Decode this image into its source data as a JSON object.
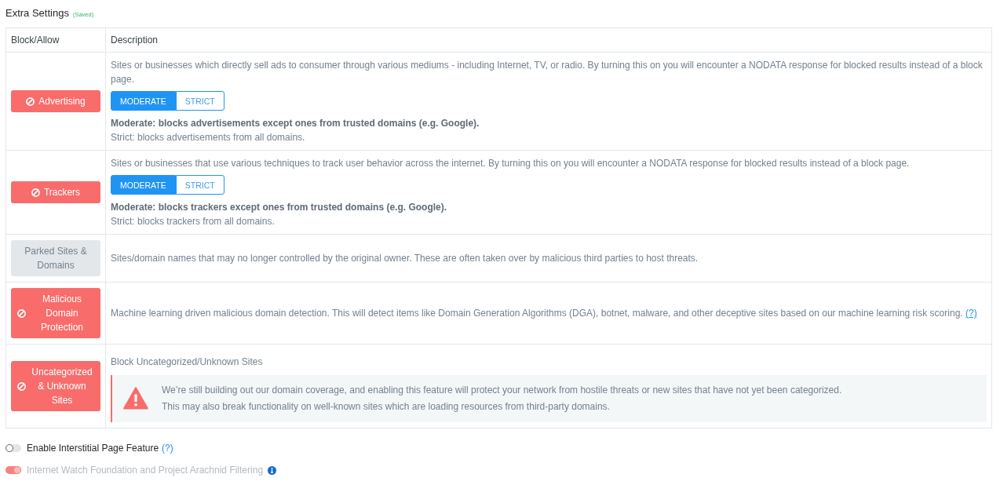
{
  "header": {
    "title": "Extra Settings",
    "status": "(Saved)"
  },
  "table": {
    "columns": [
      "Block/Allow",
      "Description"
    ],
    "rows": [
      {
        "kind": "levels",
        "category": {
          "label": "Advertising",
          "on": true
        },
        "description": "Sites or businesses which directly sell ads to consumer through various mediums - including Internet, TV, or radio. By turning this on you will encounter a NODATA response for blocked results instead of a block page.",
        "modes": [
          {
            "label": "MODERATE",
            "selected": true
          },
          {
            "label": "STRICT",
            "selected": false
          }
        ],
        "notes": [
          {
            "text": "Moderate: blocks advertisements except ones from trusted domains (e.g. Google).",
            "emphasized": true
          },
          {
            "text": "Strict: blocks advertisements from all domains.",
            "emphasized": false
          }
        ]
      },
      {
        "kind": "levels",
        "category": {
          "label": "Trackers",
          "on": true
        },
        "description": "Sites or businesses that use various techniques to track user behavior across the internet. By turning this on you will encounter a NODATA response for blocked results instead of a block page.",
        "modes": [
          {
            "label": "MODERATE",
            "selected": true
          },
          {
            "label": "STRICT",
            "selected": false
          }
        ],
        "notes": [
          {
            "text": "Moderate: blocks trackers except ones from trusted domains (e.g. Google).",
            "emphasized": true
          },
          {
            "text": "Strict: blocks trackers from all domains.",
            "emphasized": false
          }
        ]
      },
      {
        "kind": "plain",
        "category": {
          "label": "Parked Sites & Domains",
          "on": false
        },
        "description": "Sites/domain names that may no longer controlled by the original owner. These are often taken over by malicious third parties to host threats."
      },
      {
        "kind": "help",
        "category": {
          "label": "Malicious Domain Protection",
          "on": true
        },
        "description": "Machine learning driven malicious domain detection. This will detect items like Domain Generation Algorithms (DGA), botnet, malware, and other deceptive sites based on our machine learning risk scoring.",
        "help": "(?)"
      },
      {
        "kind": "warning",
        "category": {
          "label": "Uncategorized & Unknown Sites",
          "on": true
        },
        "description": "Block Uncategorized/Unknown Sites",
        "alert": [
          "We’re still building out our domain coverage, and enabling this feature will protect your network from hostile threats or new sites that have not yet been categorized.",
          "This may also break functionality on well-known sites which are loading resources from third-party domains."
        ]
      }
    ]
  },
  "options": [
    {
      "kind": "help",
      "label": "Enable Interstitial Page Feature",
      "on": false,
      "disabled": false,
      "help": "(?)"
    },
    {
      "kind": "info",
      "label": "Internet Watch Foundation and Project Arachnid Filtering",
      "on": true,
      "disabled": true
    }
  ]
}
